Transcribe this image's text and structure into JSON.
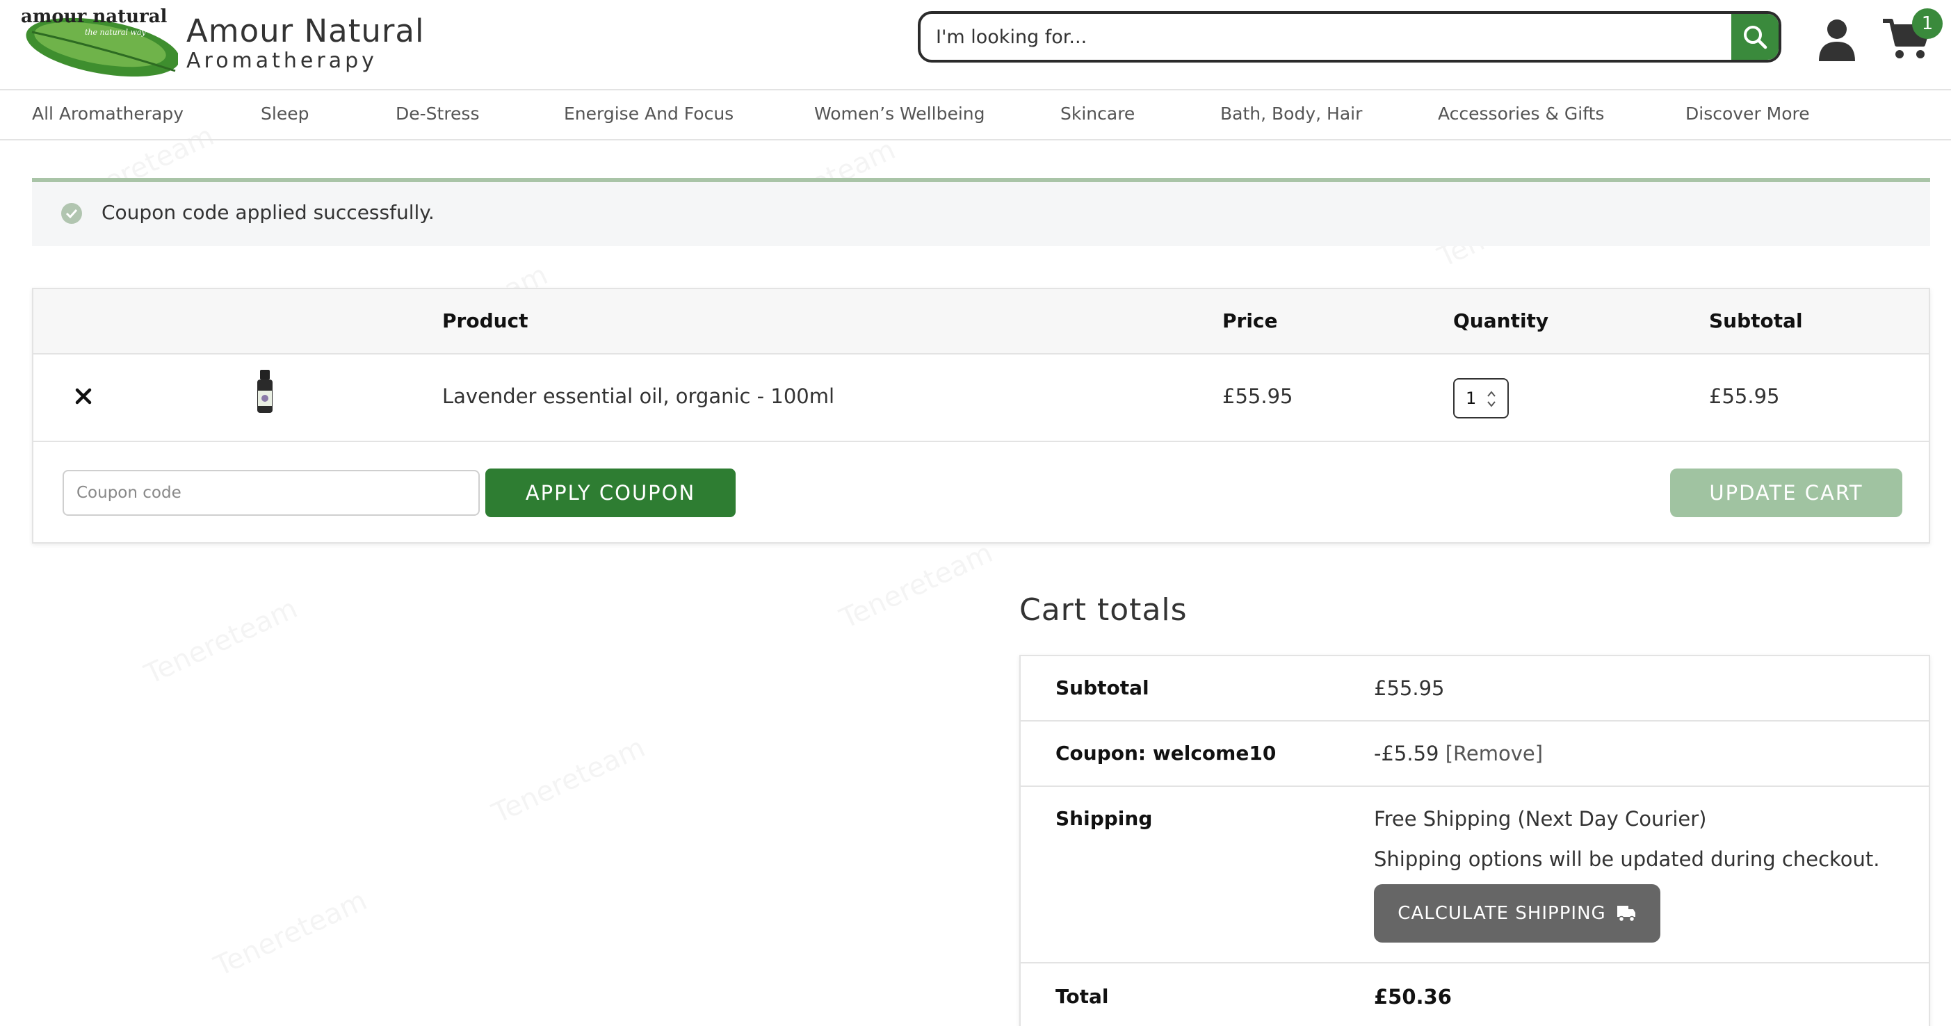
{
  "header": {
    "brand_name": "Amour Natural",
    "brand_sub": "Aromatherapy",
    "logo_text": "amour natural",
    "logo_tagline": "the natural way",
    "search_placeholder": "I'm looking for...",
    "cart_count": "1"
  },
  "nav": {
    "items": [
      "All Aromatherapy",
      "Sleep",
      "De-Stress",
      "Energise And Focus",
      "Women’s Wellbeing",
      "Skincare",
      "Bath, Body, Hair",
      "Accessories & Gifts",
      "Discover More"
    ]
  },
  "notice": {
    "text": "Coupon code applied successfully."
  },
  "cart": {
    "headers": {
      "product": "Product",
      "price": "Price",
      "quantity": "Quantity",
      "subtotal": "Subtotal"
    },
    "items": [
      {
        "name": "Lavender essential oil, organic - 100ml",
        "price": "£55.95",
        "quantity": "1",
        "subtotal": "£55.95"
      }
    ],
    "coupon_placeholder": "Coupon code",
    "apply_label": "APPLY COUPON",
    "update_label": "UPDATE CART"
  },
  "totals": {
    "title": "Cart totals",
    "subtotal_label": "Subtotal",
    "subtotal_value": "£55.95",
    "coupon_label": "Coupon: welcome10",
    "coupon_value": "-£5.59",
    "coupon_remove": "[Remove]",
    "shipping_label": "Shipping",
    "shipping_method": "Free Shipping (Next Day Courier)",
    "shipping_note": "Shipping options will be updated during checkout.",
    "calc_label": "CALCULATE SHIPPING",
    "total_label": "Total",
    "total_value": "£50.36"
  },
  "colors": {
    "brand_green": "#2e7d32",
    "search_green": "#3a8a3c",
    "update_disabled": "#a0c3a1",
    "calc_gray": "#666666"
  },
  "icons": [
    "search-icon",
    "user-icon",
    "cart-icon",
    "check-icon",
    "close-icon",
    "truck-icon"
  ],
  "watermark": "Tenereteam"
}
